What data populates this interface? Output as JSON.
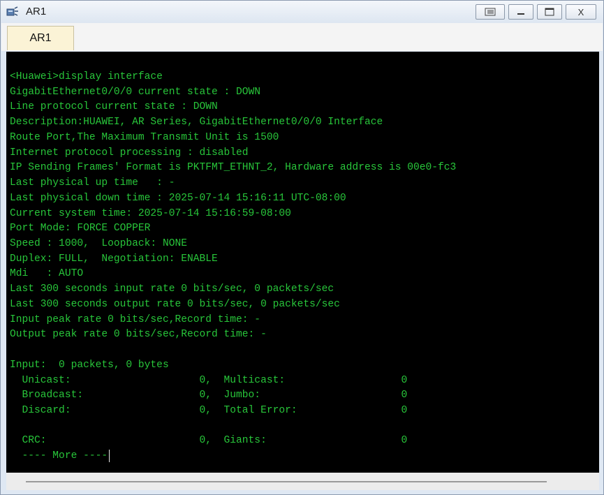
{
  "window": {
    "title": "AR1"
  },
  "controls": {
    "restore": "▭",
    "minimize": "—",
    "maximize": "☐",
    "close": "X"
  },
  "tabs": [
    {
      "label": "AR1"
    }
  ],
  "terminal": {
    "lines": [
      "<Huawei>display interface",
      "GigabitEthernet0/0/0 current state : DOWN",
      "Line protocol current state : DOWN",
      "Description:HUAWEI, AR Series, GigabitEthernet0/0/0 Interface",
      "Route Port,The Maximum Transmit Unit is 1500",
      "Internet protocol processing : disabled",
      "IP Sending Frames' Format is PKTFMT_ETHNT_2, Hardware address is 00e0-fc3",
      "Last physical up time   : -",
      "Last physical down time : 2025-07-14 15:16:11 UTC-08:00",
      "Current system time: 2025-07-14 15:16:59-08:00",
      "Port Mode: FORCE COPPER",
      "Speed : 1000,  Loopback: NONE",
      "Duplex: FULL,  Negotiation: ENABLE",
      "Mdi   : AUTO",
      "Last 300 seconds input rate 0 bits/sec, 0 packets/sec",
      "Last 300 seconds output rate 0 bits/sec, 0 packets/sec",
      "Input peak rate 0 bits/sec,Record time: -",
      "Output peak rate 0 bits/sec,Record time: -",
      "",
      "Input:  0 packets, 0 bytes",
      "  Unicast:                     0,  Multicast:                   0",
      "  Broadcast:                   0,  Jumbo:                       0",
      "  Discard:                     0,  Total Error:                 0",
      "",
      "  CRC:                         0,  Giants:                      0",
      "  ---- More ----"
    ]
  }
}
